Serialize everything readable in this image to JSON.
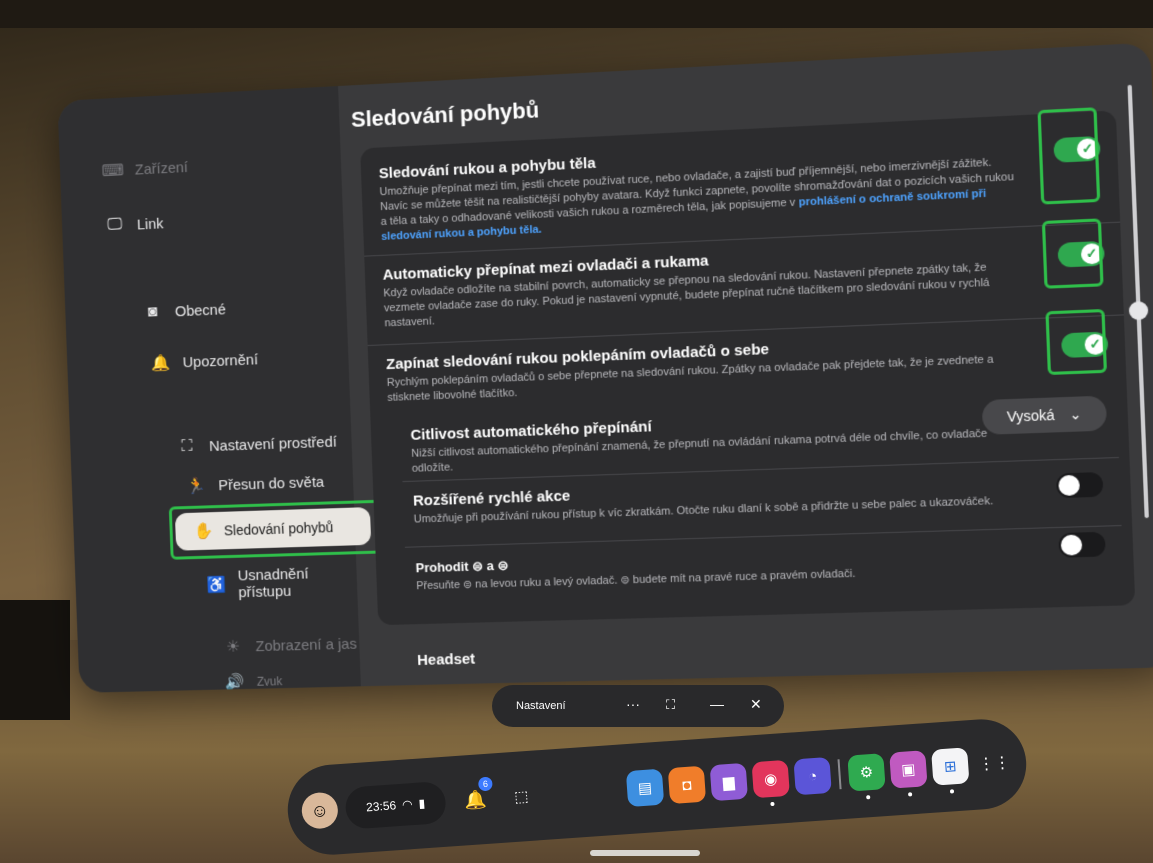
{
  "sidebar": {
    "items": [
      {
        "label": "Zařízení",
        "icon": "device-icon"
      },
      {
        "label": "Link",
        "icon": "link-icon"
      },
      {
        "label": "Obecné",
        "icon": "headset-icon"
      },
      {
        "label": "Upozornění",
        "icon": "bell-icon"
      },
      {
        "label": "Nastavení prostředí",
        "icon": "environment-icon"
      },
      {
        "label": "Přesun do světa",
        "icon": "move-icon"
      },
      {
        "label": "Sledování pohybů",
        "icon": "tracking-icon"
      },
      {
        "label": "Usnadnění přístupu",
        "icon": "accessibility-icon"
      },
      {
        "label": "Zobrazení a jas",
        "icon": "brightness-icon"
      },
      {
        "label": "Zvuk",
        "icon": "sound-icon"
      }
    ],
    "active_index": 6
  },
  "main": {
    "title": "Sledování pohybů",
    "settings": [
      {
        "title": "Sledování rukou a pohybu těla",
        "description": "Umožňuje přepínat mezi tím, jestli chcete používat ruce, nebo ovladače, a zajistí buď příjemnější, nebo imerzivnější zážitek. Navíc se můžete těšit na realističtější pohyby avatara. Když funkci zapnete, povolíte shromažďování dat o pozicích vašich rukou a těla a taky o odhadované velikosti vašich rukou a rozměrech těla, jak popisujeme v",
        "link": "prohlášení o ochraně soukromí při sledování rukou a pohybu těla.",
        "state": true
      },
      {
        "title": "Automaticky přepínat mezi ovladači a rukama",
        "description": "Když ovladače odložíte na stabilní povrch, automaticky se přepnou na sledování rukou. Nastavení přepnete zpátky tak, že vezmete ovladače zase do ruky. Pokud je nastavení vypnuté, budete přepínat ručně tlačítkem pro sledování rukou v rychlá nastavení.",
        "state": true
      },
      {
        "title": "Zapínat sledování rukou poklepáním ovladačů o sebe",
        "description": "Rychlým poklepáním ovladačů o sebe přepnete na sledování rukou. Zpátky na ovladače pak přejdete tak, že je zvednete a stisknete libovolné tlačítko.",
        "state": true
      },
      {
        "title": "Citlivost automatického přepínání",
        "description": "Nižší citlivost automatického přepínání znamená, že přepnutí na ovládání rukama potrvá déle od chvíle, co ovladače odložíte.",
        "value": "Vysoká"
      },
      {
        "title": "Rozšířené rychlé akce",
        "description": "Umožňuje při používání rukou přístup k víc zkratkám. Otočte ruku dlaní k sobě a přidržte u sebe palec a ukazováček.",
        "state": false
      },
      {
        "title": "Prohodit ⊜ a ⊜",
        "description": "Přesuňte ⊜ na levou ruku a levý ovladač. ⊜ budete mít na pravé ruce a pravém ovladači.",
        "state": false
      }
    ],
    "section_headset": "Headset"
  },
  "window_bar": {
    "label": "Nastavení",
    "more": "···",
    "expand": "⛶",
    "minimize": "—",
    "close": "✕"
  },
  "dock": {
    "time": "23:56",
    "notifications_count": "6",
    "apps": [
      {
        "name": "store-app",
        "color": "#3d8fe0",
        "glyph": "▤"
      },
      {
        "name": "shop-app",
        "color": "#f07d2a",
        "glyph": "◘"
      },
      {
        "name": "chat-app",
        "color": "#8f5cd6",
        "glyph": "▆"
      },
      {
        "name": "camera-app",
        "color": "#e2355c",
        "glyph": "◉"
      },
      {
        "name": "browser-app",
        "color": "#5b55d8",
        "glyph": "◔"
      },
      {
        "name": "settings-app",
        "color": "#2faa50",
        "glyph": "⚙"
      },
      {
        "name": "gallery-app",
        "color": "#c05ac0",
        "glyph": "▣"
      },
      {
        "name": "windows-app",
        "color": "#f4f4f6",
        "glyph": "⊞"
      }
    ]
  },
  "colors": {
    "toggle_on": "#2fa84f",
    "highlight_box": "#2fbf4a",
    "link": "#4ea3ff"
  }
}
